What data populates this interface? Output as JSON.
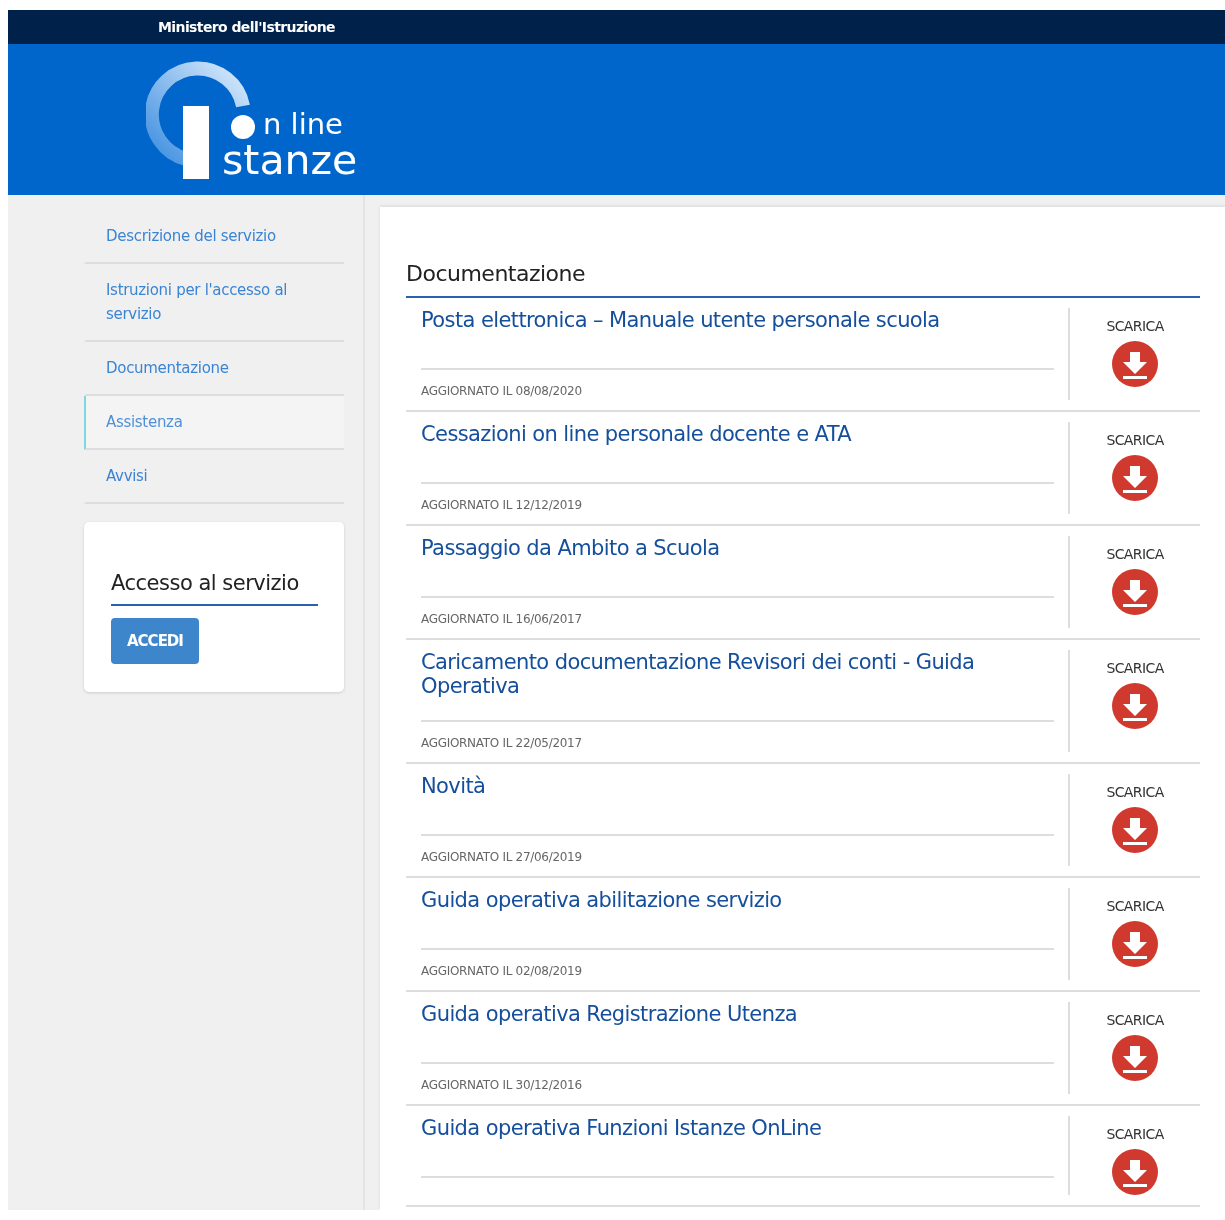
{
  "top_bar": {
    "title": "Ministero dell'Istruzione"
  },
  "logo": {
    "line1": "n line",
    "line2": "stanze"
  },
  "sidebar": {
    "items": [
      {
        "label": "Descrizione del servizio",
        "selected": false
      },
      {
        "label": "Istruzioni per l'accesso al servizio",
        "selected": false
      },
      {
        "label": "Documentazione",
        "selected": false
      },
      {
        "label": "Assistenza",
        "selected": true
      },
      {
        "label": "Avvisi",
        "selected": false
      }
    ],
    "access_card": {
      "title": "Accesso al servizio",
      "button": "ACCEDI"
    }
  },
  "main": {
    "heading": "Documentazione",
    "documents": [
      {
        "title": "Posta elettronica – Manuale utente personale scuola",
        "updated": "AGGIORNATO IL 08/08/2020",
        "action": "SCARICA"
      },
      {
        "title": "Cessazioni on line personale docente e ATA",
        "updated": "AGGIORNATO IL 12/12/2019",
        "action": "SCARICA"
      },
      {
        "title": "Passaggio da Ambito a Scuola",
        "updated": "AGGIORNATO IL 16/06/2017",
        "action": "SCARICA"
      },
      {
        "title": "Caricamento documentazione Revisori dei conti - Guida Operativa",
        "updated": "AGGIORNATO IL 22/05/2017",
        "action": "SCARICA"
      },
      {
        "title": "Novità",
        "updated": "AGGIORNATO IL 27/06/2019",
        "action": "SCARICA"
      },
      {
        "title": "Guida operativa abilitazione servizio",
        "updated": "AGGIORNATO IL 02/08/2019",
        "action": "SCARICA"
      },
      {
        "title": "Guida operativa Registrazione Utenza",
        "updated": "AGGIORNATO IL 30/12/2016",
        "action": "SCARICA"
      },
      {
        "title": "Guida operativa Funzioni Istanze OnLine",
        "action": "SCARICA"
      }
    ]
  }
}
